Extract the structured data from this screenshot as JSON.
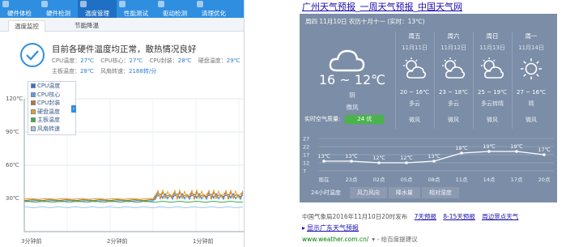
{
  "monitor": {
    "nav_items": [
      {
        "label": "硬件体检",
        "active": false
      },
      {
        "label": "硬件检测",
        "active": false
      },
      {
        "label": "温度管理",
        "active": true
      },
      {
        "label": "性能测试",
        "active": false
      },
      {
        "label": "驱动检测",
        "active": false
      },
      {
        "label": "清理优化",
        "active": false
      }
    ],
    "subtabs": [
      "温度监控",
      "节能降温"
    ],
    "status_title": "目前各硬件温度均正常，散热情况良好",
    "temps_row1": [
      {
        "label": "CPU温度：",
        "value": "27℃"
      },
      {
        "label": "CPU核心：",
        "value": "27℃"
      },
      {
        "label": "CPU封装：",
        "value": "28℃"
      },
      {
        "label": "硬盘温度：",
        "value": "29℃"
      }
    ],
    "temps_row2": [
      {
        "label": "主板温度：",
        "value": "28℃"
      },
      {
        "label": "风扇转速：",
        "value": "2188转/分"
      }
    ],
    "legend": [
      {
        "label": "CPU温度",
        "color": "#3a6fd8"
      },
      {
        "label": "CPU核心",
        "color": "#5aa0e6"
      },
      {
        "label": "CPU封装",
        "color": "#c07030"
      },
      {
        "label": "硬盘温度",
        "color": "#e8a020"
      },
      {
        "label": "主板温度",
        "color": "#3ab04a"
      },
      {
        "label": "风扇转速",
        "color": "#9ec8ee"
      }
    ],
    "legend_toggle": "›",
    "y_ticks": [
      "120℃",
      "90℃",
      "60℃",
      "30℃"
    ],
    "x_ticks": [
      "3分钟前",
      "2分钟前",
      "1分钟前"
    ]
  },
  "weather": {
    "title": [
      "广州天气预报",
      "一周天气预报",
      "中国天气网"
    ],
    "header": "周四 11月10日  农历十月十一  (实时：13℃)",
    "today": {
      "temp": "16 ~ 12℃",
      "desc": "阴",
      "wind": "微风"
    },
    "air_quality": {
      "label": "实时空气质量:",
      "value": "24 优"
    },
    "days": [
      {
        "name": "周五",
        "date": "11月11日",
        "icon": "partly-cloudy-icon",
        "temp": "20 ~ 16℃",
        "desc": "多云",
        "wind": "微风"
      },
      {
        "name": "周六",
        "date": "11月12日",
        "icon": "partly-cloudy-icon",
        "temp": "23 ~ 18℃",
        "desc": "多云",
        "wind": "微风"
      },
      {
        "name": "周日",
        "date": "11月13日",
        "icon": "partly-cloudy-icon",
        "temp": "25 ~ 19℃",
        "desc": "多云转晴",
        "wind": "微风"
      },
      {
        "name": "周一",
        "date": "11月14日",
        "icon": "sun-icon",
        "temp": "27 ~ 16℃",
        "desc": "晴",
        "wind": "微风"
      }
    ],
    "hourly": {
      "y_ticks": [
        "27",
        "22",
        "17",
        "12",
        "7"
      ],
      "hours": [
        "现在",
        "23点",
        "02点",
        "05点",
        "08点",
        "11点",
        "14点",
        "17点",
        "20点"
      ],
      "temps": [
        13,
        13,
        12,
        12,
        13,
        18,
        19,
        19,
        17
      ],
      "labels": [
        "13℃",
        "13℃",
        "12℃",
        "12℃",
        "13℃",
        "18℃",
        "19℃",
        "19℃",
        "17℃"
      ]
    },
    "tabs": [
      "24小时温度",
      "风力风向",
      "降水量",
      "相对湿度"
    ],
    "source": "中国气象局2016年11月10日20时发布",
    "links": [
      "7天预报",
      "8-15天预报",
      "周边景点天气"
    ],
    "province": "显示广东天气预报",
    "url": "www.weather.com.cn/",
    "feedback": "给百度提建议"
  }
}
